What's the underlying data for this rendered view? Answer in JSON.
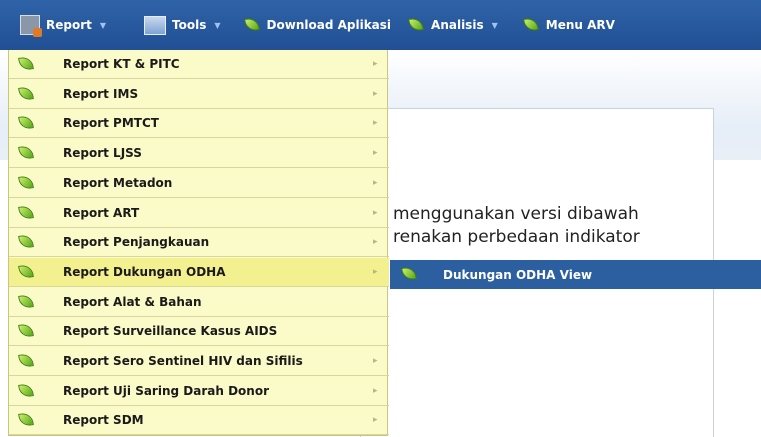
{
  "menubar": {
    "items": [
      {
        "label": "Report",
        "icon": "report-icon",
        "has_dropdown": true
      },
      {
        "label": "Tools",
        "icon": "tools-icon",
        "has_dropdown": true
      },
      {
        "label": "Download Aplikasi",
        "icon": "leaf-icon",
        "has_dropdown": false
      },
      {
        "label": "Analisis",
        "icon": "leaf-icon",
        "has_dropdown": true
      },
      {
        "label": "Menu ARV",
        "icon": "leaf-icon",
        "has_dropdown": false
      }
    ],
    "dropdown_glyph": "▼",
    "colors": {
      "bar": "#2a5a9d",
      "text": "#ffffff"
    }
  },
  "report_menu": {
    "items": [
      {
        "label": "Report KT & PITC",
        "has_submenu": true
      },
      {
        "label": "Report IMS",
        "has_submenu": true
      },
      {
        "label": "Report PMTCT",
        "has_submenu": true
      },
      {
        "label": "Report LJSS",
        "has_submenu": true
      },
      {
        "label": "Report Metadon",
        "has_submenu": true
      },
      {
        "label": "Report ART",
        "has_submenu": true
      },
      {
        "label": "Report Penjangkauan",
        "has_submenu": true
      },
      {
        "label": "Report Dukungan ODHA",
        "has_submenu": true,
        "active": true
      },
      {
        "label": "Report Alat & Bahan",
        "has_submenu": false
      },
      {
        "label": "Report Surveillance Kasus AIDS",
        "has_submenu": false
      },
      {
        "label": "Report Sero Sentinel HIV dan Sifilis",
        "has_submenu": true
      },
      {
        "label": "Report Uji Saring Darah Donor",
        "has_submenu": true
      },
      {
        "label": "Report SDM",
        "has_submenu": true
      }
    ],
    "submenu_arrow": "▸",
    "colors": {
      "background": "#fafbc8",
      "active": "#f2f08f"
    }
  },
  "submenu": {
    "label": "Dukungan ODHA View",
    "color": "#2b5f9f"
  },
  "content": {
    "line1": "menggunakan versi dibawah",
    "line2": "renakan perbedaan indikator"
  }
}
